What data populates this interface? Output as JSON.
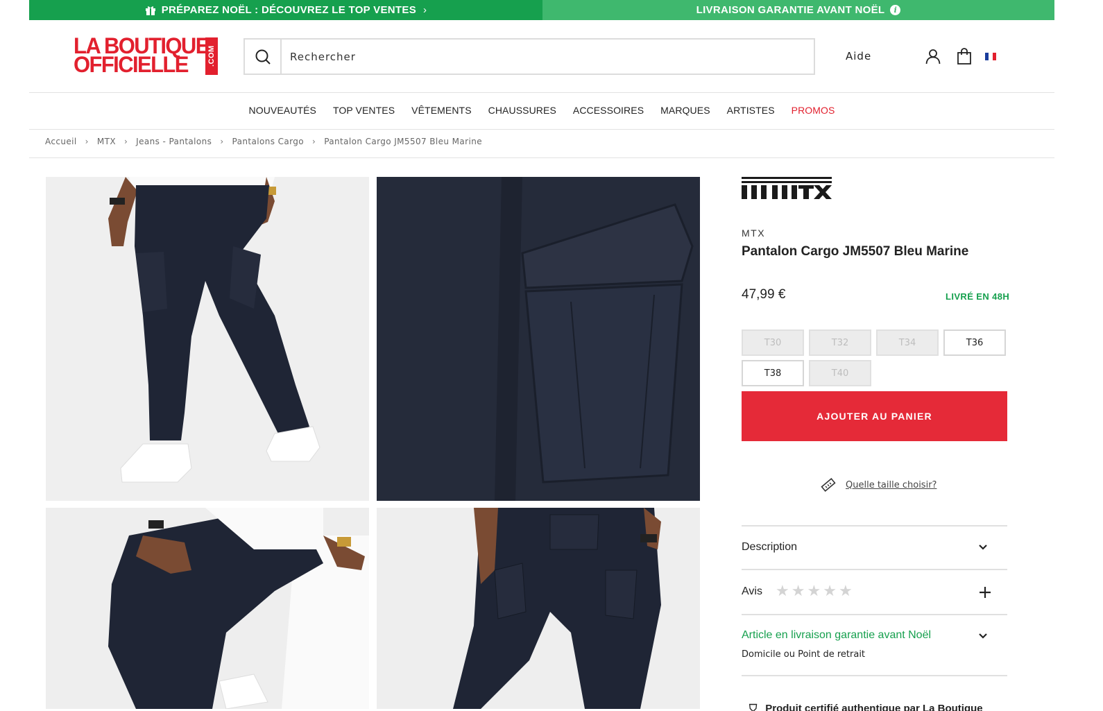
{
  "promo": {
    "left_text": "PRÉPAREZ NOËL : DÉCOUVREZ LE TOP VENTES",
    "right_text": "LIVRAISON GARANTIE AVANT NOËL",
    "left_bg": "#16a04e",
    "right_bg": "#3fb86e"
  },
  "header": {
    "logo_line1": "LA BOUTIQUE",
    "logo_line2": "OFFICIELLE",
    "logo_suffix": ".COM",
    "search_placeholder": "Rechercher",
    "help_label": "Aide",
    "icons": [
      "search-icon",
      "user-icon",
      "bag-icon",
      "flag-fr-icon"
    ]
  },
  "nav": {
    "items": [
      "NOUVEAUTÉS",
      "TOP VENTES",
      "VÊTEMENTS",
      "CHAUSSURES",
      "ACCESSOIRES",
      "MARQUES",
      "ARTISTES",
      "PROMOS"
    ]
  },
  "breadcrumb": {
    "items": [
      "Accueil",
      "MTX",
      "Jeans - Pantalons",
      "Pantalons Cargo",
      "Pantalon Cargo JM5507 Bleu Marine"
    ]
  },
  "product": {
    "brand": "MTX",
    "title": "Pantalon Cargo JM5507 Bleu Marine",
    "price": "47,99 €",
    "delivery": "LIVRÉ EN 48H",
    "sizes": [
      {
        "label": "T30",
        "available": false
      },
      {
        "label": "T32",
        "available": false
      },
      {
        "label": "T34",
        "available": false
      },
      {
        "label": "T36",
        "available": true
      },
      {
        "label": "T38",
        "available": true
      },
      {
        "label": "T40",
        "available": false
      }
    ],
    "add_to_cart": "AJOUTER AU PANIER",
    "size_help": "Quelle taille choisir?",
    "accordion": {
      "description": "Description",
      "reviews": "Avis",
      "rating": 0,
      "rating_max": 5,
      "shipping_title": "Article en livraison garantie avant Noël",
      "shipping_sub": "Domicile ou Point de retrait"
    },
    "authentic": "Produit certifié authentique par La Boutique"
  },
  "colors": {
    "accent_red": "#e52a38",
    "brand_red": "#e2202e",
    "green": "#16a04e",
    "pants": "#1f2535"
  }
}
